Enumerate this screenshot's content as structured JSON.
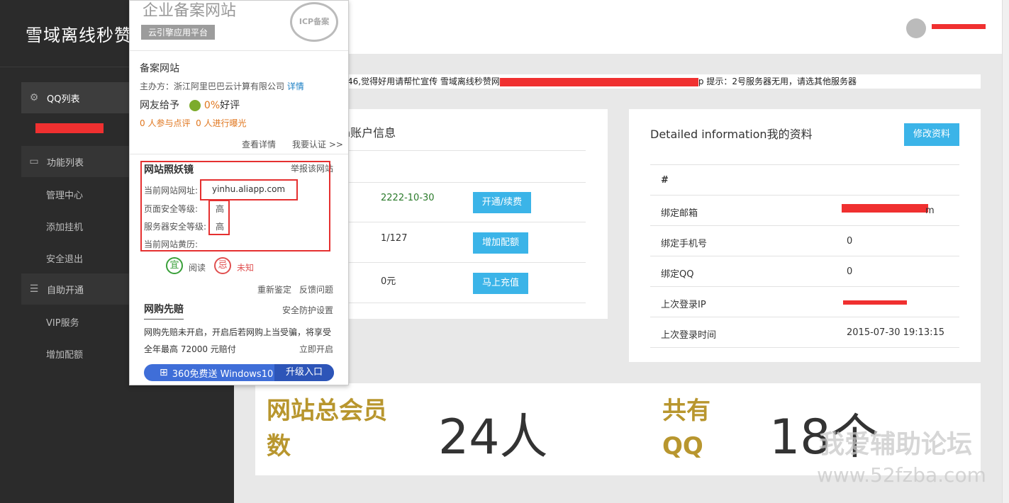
{
  "sidebar": {
    "brand": "雪域离线秒赞",
    "items": [
      {
        "label": "QQ列表",
        "icon": "gear-icon"
      },
      {
        "label": "功能列表",
        "icon": "monitor-icon"
      },
      {
        "label": "自助开通",
        "icon": "database-icon"
      }
    ],
    "sub_items_func": [
      "管理中心",
      "添加挂机",
      "安全退出"
    ],
    "sub_items_self": [
      "VIP服务",
      "增加配额"
    ]
  },
  "notice": {
    "text_left": "46,觉得好用请帮忙宣传 雪域离线秒赞网",
    "text_right": "p 提示：2号服务器无用，请选其他服务器"
  },
  "account_card": {
    "title": "n账户信息",
    "rows": [
      {
        "value": "2222-10-30",
        "button": "开通/续费"
      },
      {
        "value": "1/127",
        "button": "增加配额"
      },
      {
        "value": "0元",
        "button": "马上充值"
      }
    ]
  },
  "profile_card": {
    "title": "Detailed information我的资料",
    "edit_button": "修改资料",
    "header": "#",
    "rows": [
      {
        "label": "绑定邮箱",
        "value": "m"
      },
      {
        "label": "绑定手机号",
        "value": "0"
      },
      {
        "label": "绑定QQ",
        "value": "0"
      },
      {
        "label": "上次登录IP",
        "value": ""
      },
      {
        "label": "上次登录时间",
        "value": "2015-07-30 19:13:15"
      }
    ]
  },
  "popup": {
    "title": "企业备案网站",
    "platform_tag": "云引擎应用平台",
    "stamp": "ICP备案",
    "site_type": "备案网站",
    "sponsor_label": "主办方：浙江阿里巴巴云计算有限公司",
    "details_link": "详情",
    "rating_label": "网友给予",
    "rating_value": "0%",
    "rating_suffix": "好评",
    "participate": "0 人参与点评",
    "exposure": "0 人进行曝光",
    "view_details": "查看详情",
    "certify": "我要认证 >>",
    "mirror_title": "网站照妖镜",
    "report_link": "举报该网站",
    "url_label": "当前网站网址:",
    "url_value": "yinhu.aliapp.com",
    "page_security_label": "页面安全等级:",
    "page_security_value": "高",
    "server_security_label": "服务器安全等级:",
    "server_security_value": "高",
    "history_label": "当前网站黄历:",
    "good_char": "宜",
    "good_text": "阅读",
    "bad_char": "忌",
    "bad_text": "未知",
    "reidentify": "重新鉴定",
    "feedback": "反馈问题",
    "shop_title": "网购先赔",
    "security_settings": "安全防护设置",
    "shop_desc_1": "网购先赔未开启，开启后若网购上当受骗，将享受",
    "shop_desc_2": "全年最高 72000 元赔付",
    "enable_now": "立即开启",
    "win_label": "360免费送 Windows10",
    "upgrade": "升级入口"
  },
  "stats": {
    "members_label_1": "网站总会员",
    "members_label_2": "数",
    "members_value": "24人",
    "qq_label_1": "共有",
    "qq_label_2": "QQ",
    "qq_value": "18个"
  },
  "watermark": {
    "line1": "我爱辅助论坛",
    "line2": "www.52fzba.com"
  }
}
